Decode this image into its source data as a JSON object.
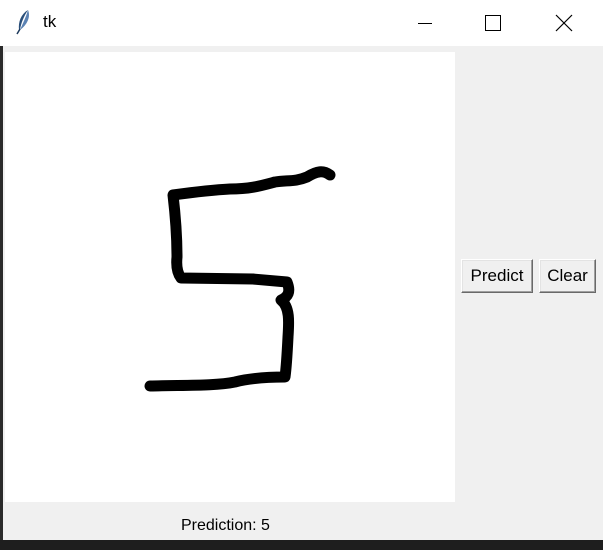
{
  "window": {
    "title": "tk",
    "icon": "feather-icon"
  },
  "controls": {
    "minimize_icon": "minimize-icon",
    "maximize_icon": "maximize-icon",
    "close_icon": "close-icon"
  },
  "buttons": {
    "predict_label": "Predict",
    "clear_label": "Clear"
  },
  "status": {
    "prediction_text": "Prediction: 5"
  },
  "colors": {
    "background": "#f0f0f0",
    "canvas": "#ffffff",
    "stroke": "#000000"
  }
}
